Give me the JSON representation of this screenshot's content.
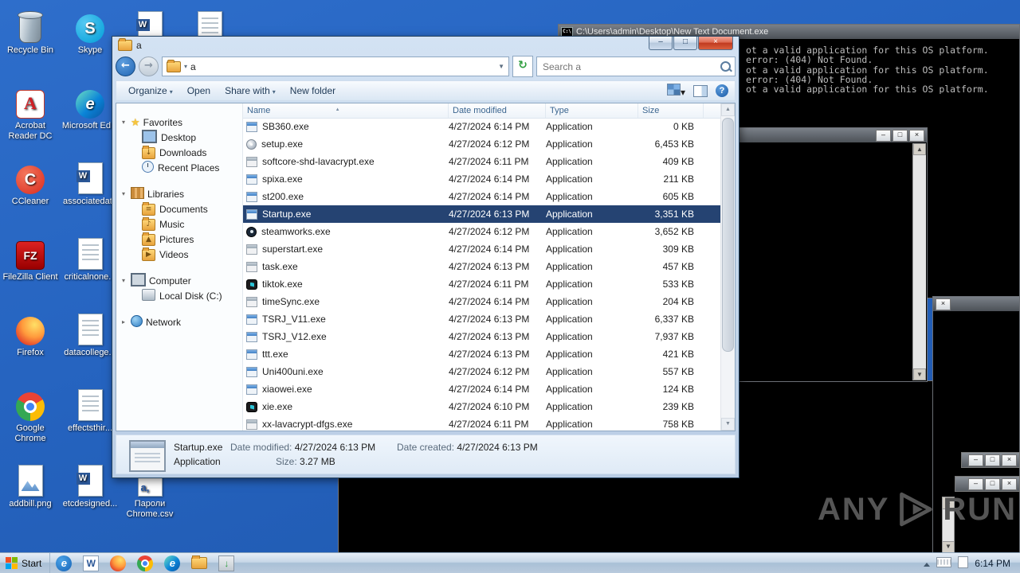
{
  "explorer": {
    "title": "a",
    "address": {
      "breadcrumb": "a"
    },
    "search": {
      "placeholder": "Search a"
    },
    "toolbar": {
      "items": [
        "Organize",
        "Open",
        "Share with",
        "New folder"
      ]
    },
    "nav": [
      {
        "label": "Favorites",
        "icon": "favorites-star-icon",
        "expanded": true,
        "items": [
          {
            "label": "Desktop",
            "icon": "desktop-mini-icon"
          },
          {
            "label": "Downloads",
            "icon": "downloads-folder-icon"
          },
          {
            "label": "Recent Places",
            "icon": "recent-places-icon"
          }
        ]
      },
      {
        "label": "Libraries",
        "icon": "libraries-icon",
        "expanded": true,
        "items": [
          {
            "label": "Documents",
            "icon": "documents-library-icon"
          },
          {
            "label": "Music",
            "icon": "music-library-icon"
          },
          {
            "label": "Pictures",
            "icon": "pictures-library-icon"
          },
          {
            "label": "Videos",
            "icon": "videos-library-icon"
          }
        ]
      },
      {
        "label": "Computer",
        "icon": "computer-icon",
        "expanded": true,
        "items": [
          {
            "label": "Local Disk (C:)",
            "icon": "local-disk-icon"
          }
        ]
      },
      {
        "label": "Network",
        "icon": "network-icon",
        "expanded": false,
        "items": []
      }
    ],
    "columns": [
      "Name",
      "Date modified",
      "Type",
      "Size"
    ],
    "files": [
      {
        "name": "SB360.exe",
        "date": "4/27/2024 6:14 PM",
        "type": "Application",
        "size": "0 KB",
        "icon": "app",
        "selected": false
      },
      {
        "name": "setup.exe",
        "date": "4/27/2024 6:12 PM",
        "type": "Application",
        "size": "6,453 KB",
        "icon": "disc",
        "selected": false
      },
      {
        "name": "softcore-shd-lavacrypt.exe",
        "date": "4/27/2024 6:11 PM",
        "type": "Application",
        "size": "409 KB",
        "icon": "gray",
        "selected": false
      },
      {
        "name": "spixa.exe",
        "date": "4/27/2024 6:14 PM",
        "type": "Application",
        "size": "211 KB",
        "icon": "app",
        "selected": false
      },
      {
        "name": "st200.exe",
        "date": "4/27/2024 6:14 PM",
        "type": "Application",
        "size": "605 KB",
        "icon": "app",
        "selected": false
      },
      {
        "name": "Startup.exe",
        "date": "4/27/2024 6:13 PM",
        "type": "Application",
        "size": "3,351 KB",
        "icon": "app",
        "selected": true
      },
      {
        "name": "steamworks.exe",
        "date": "4/27/2024 6:12 PM",
        "type": "Application",
        "size": "3,652 KB",
        "icon": "steam",
        "selected": false
      },
      {
        "name": "superstart.exe",
        "date": "4/27/2024 6:14 PM",
        "type": "Application",
        "size": "309 KB",
        "icon": "gray",
        "selected": false
      },
      {
        "name": "task.exe",
        "date": "4/27/2024 6:13 PM",
        "type": "Application",
        "size": "457 KB",
        "icon": "gray",
        "selected": false
      },
      {
        "name": "tiktok.exe",
        "date": "4/27/2024 6:11 PM",
        "type": "Application",
        "size": "533 KB",
        "icon": "dark",
        "selected": false
      },
      {
        "name": "timeSync.exe",
        "date": "4/27/2024 6:14 PM",
        "type": "Application",
        "size": "204 KB",
        "icon": "gray",
        "selected": false
      },
      {
        "name": "TSRJ_V11.exe",
        "date": "4/27/2024 6:13 PM",
        "type": "Application",
        "size": "6,337 KB",
        "icon": "app",
        "selected": false
      },
      {
        "name": "TSRJ_V12.exe",
        "date": "4/27/2024 6:13 PM",
        "type": "Application",
        "size": "7,937 KB",
        "icon": "app",
        "selected": false
      },
      {
        "name": "ttt.exe",
        "date": "4/27/2024 6:13 PM",
        "type": "Application",
        "size": "421 KB",
        "icon": "app",
        "selected": false
      },
      {
        "name": "Uni400uni.exe",
        "date": "4/27/2024 6:12 PM",
        "type": "Application",
        "size": "557 KB",
        "icon": "app",
        "selected": false
      },
      {
        "name": "xiaowei.exe",
        "date": "4/27/2024 6:14 PM",
        "type": "Application",
        "size": "124 KB",
        "icon": "app",
        "selected": false
      },
      {
        "name": "xie.exe",
        "date": "4/27/2024 6:10 PM",
        "type": "Application",
        "size": "239 KB",
        "icon": "dark",
        "selected": false
      },
      {
        "name": "xx-lavacrypt-dfgs.exe",
        "date": "4/27/2024 6:11 PM",
        "type": "Application",
        "size": "758 KB",
        "icon": "gray",
        "selected": false
      }
    ],
    "details": {
      "name": "Startup.exe",
      "type": "Application",
      "modified_label": "Date modified:",
      "modified": "4/27/2024 6:13 PM",
      "created_label": "Date created:",
      "created": "4/27/2024 6:13 PM",
      "size_label": "Size:",
      "size": "3.27 MB"
    }
  },
  "consoles": {
    "error_console": {
      "title": "C:\\Users\\admin\\Desktop\\New Text Document.exe",
      "lines": [
        "ot a valid application for this OS platform.",
        "error: (404) Not Found.",
        "ot a valid application for this OS platform.",
        "error: (404) Not Found.",
        "ot a valid application for this OS platform."
      ]
    }
  },
  "desktop": {
    "icons": [
      {
        "label": "Recycle Bin",
        "icon": "recycle-bin-icon",
        "col": 0,
        "row": 0
      },
      {
        "label": "Skype",
        "icon": "skype-icon",
        "col": 1,
        "row": 0
      },
      {
        "label": "",
        "icon": "word-doc-icon",
        "col": 2,
        "row": 0
      },
      {
        "label": "",
        "icon": "document-icon",
        "col": 3,
        "row": 0
      },
      {
        "label": "Acrobat Reader DC",
        "icon": "acrobat-icon",
        "col": 0,
        "row": 1
      },
      {
        "label": "Microsoft Ed...",
        "icon": "edge-icon",
        "col": 1,
        "row": 1
      },
      {
        "label": "CCleaner",
        "icon": "ccleaner-icon",
        "col": 0,
        "row": 2
      },
      {
        "label": "associatedata",
        "icon": "word-doc-icon",
        "col": 1,
        "row": 2
      },
      {
        "label": "FileZilla Client",
        "icon": "filezilla-icon",
        "col": 0,
        "row": 3
      },
      {
        "label": "criticalnone...",
        "icon": "text-doc-icon",
        "col": 1,
        "row": 3
      },
      {
        "label": "Firefox",
        "icon": "firefox-icon",
        "col": 0,
        "row": 4
      },
      {
        "label": "datacollege...",
        "icon": "text-doc-icon",
        "col": 1,
        "row": 4
      },
      {
        "label": "Google Chrome",
        "icon": "chrome-icon",
        "col": 0,
        "row": 5
      },
      {
        "label": "effectsthir...",
        "icon": "text-doc-icon",
        "col": 1,
        "row": 5
      },
      {
        "label": "addbill.png",
        "icon": "image-icon",
        "col": 0,
        "row": 6
      },
      {
        "label": "etcdesigned...",
        "icon": "word-doc-icon",
        "col": 1,
        "row": 6
      },
      {
        "label": "Пароли Chrome.csv",
        "icon": "csv-icon",
        "col": 2,
        "row": 6
      }
    ]
  },
  "taskbar": {
    "start_label": "Start",
    "quick_launch": [
      "internet-explorer-icon",
      "word-icon",
      "firefox-icon",
      "chrome-icon",
      "edge-icon",
      "folder-icon",
      "installer-icon"
    ],
    "tray_icons": [
      "hidden-icons-chevron-icon",
      "keyboard-icon",
      "notes-icon"
    ],
    "clock": "6:14 PM"
  },
  "watermark": {
    "left": "ANY",
    "right": "RUN"
  }
}
